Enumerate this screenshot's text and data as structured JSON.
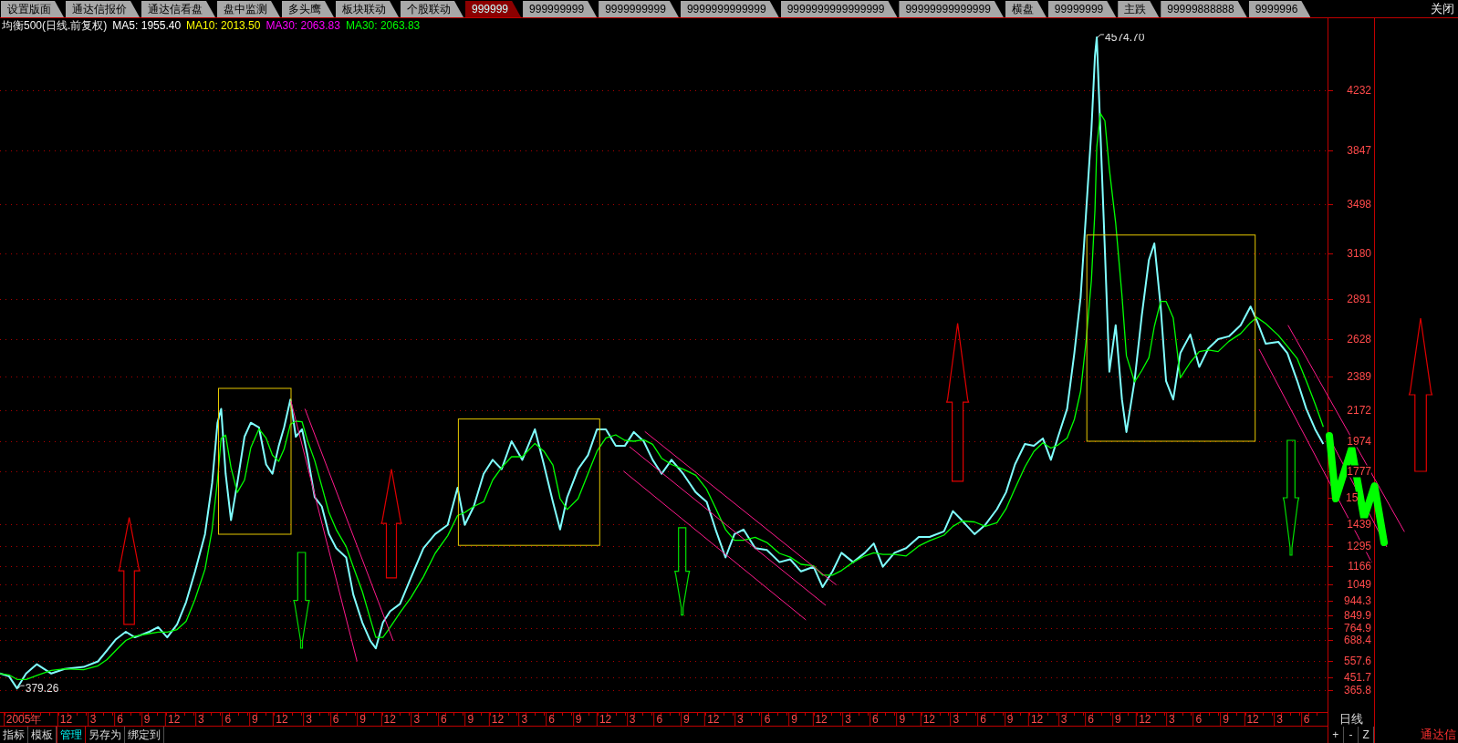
{
  "tabs": [
    {
      "label": "设置版面",
      "selected": false
    },
    {
      "label": "通达信报价",
      "selected": false
    },
    {
      "label": "通达信看盘",
      "selected": false
    },
    {
      "label": "盘中监测",
      "selected": false
    },
    {
      "label": "多头鹰",
      "selected": false
    },
    {
      "label": "板块联动",
      "selected": false
    },
    {
      "label": "个股联动",
      "selected": false
    },
    {
      "label": "999999",
      "selected": true
    },
    {
      "label": "999999999",
      "selected": false
    },
    {
      "label": "9999999999",
      "selected": false
    },
    {
      "label": "9999999999999",
      "selected": false
    },
    {
      "label": "9999999999999999",
      "selected": false
    },
    {
      "label": "99999999999999",
      "selected": false
    },
    {
      "label": "横盘",
      "selected": false
    },
    {
      "label": "99999999",
      "selected": false
    },
    {
      "label": "主跌",
      "selected": false
    },
    {
      "label": "99999888888",
      "selected": false
    },
    {
      "label": "9999996",
      "selected": false
    }
  ],
  "close_button": "关闭",
  "chart": {
    "title": "均衡500(日线.前复权)",
    "indicators": [
      {
        "label": "MA5: 1955.40",
        "color": "#ffffff"
      },
      {
        "label": "MA10: 2013.50",
        "color": "#ffff00"
      },
      {
        "label": "MA30: 2063.83",
        "color": "#ff00ff"
      },
      {
        "label": "MA30: 2063.83",
        "color": "#00ff00"
      }
    ],
    "chart_data": {
      "type": "line",
      "grid": true,
      "x": [
        "2005-04-25",
        "2005-05-25",
        "2005-06-22",
        "2005-07-22",
        "2005-08-28",
        "2005-10-16",
        "2005-12-01",
        "2006-02-04",
        "2006-03-22",
        "2006-04-22",
        "2006-05-22",
        "2006-06-25",
        "2006-07-25",
        "2006-09-13",
        "2006-10-13",
        "2006-11-13",
        "2006-12-16",
        "2007-01-16",
        "2007-02-16",
        "2007-03-19",
        "2007-04-13",
        "2007-05-01",
        "2007-05-13",
        "2007-05-28",
        "2007-06-16",
        "2007-07-07",
        "2007-08-01",
        "2007-08-22",
        "2007-09-19",
        "2007-10-13",
        "2007-11-04",
        "2007-11-25",
        "2007-12-13",
        "2008-01-04",
        "2008-01-22",
        "2008-02-13",
        "2008-03-01",
        "2008-03-25",
        "2008-04-19",
        "2008-05-13",
        "2008-06-07",
        "2008-07-10",
        "2008-08-04",
        "2008-09-04",
        "2008-10-01",
        "2008-10-19",
        "2008-11-13",
        "2008-12-07",
        "2009-01-10",
        "2009-02-16",
        "2009-03-28",
        "2009-05-07",
        "2009-06-19",
        "2009-07-22",
        "2009-08-16",
        "2009-09-16",
        "2009-10-19",
        "2009-11-19",
        "2009-12-19",
        "2010-01-22",
        "2010-02-28",
        "2010-04-10",
        "2010-05-10",
        "2010-06-10",
        "2010-07-04",
        "2010-07-28",
        "2010-09-04",
        "2010-10-07",
        "2010-11-07",
        "2010-12-07",
        "2011-01-10",
        "2011-02-10",
        "2011-03-10",
        "2011-04-13",
        "2011-05-13",
        "2011-06-13",
        "2011-07-16",
        "2011-08-25",
        "2011-10-07",
        "2011-11-13",
        "2011-12-13",
        "2012-01-16",
        "2012-02-16",
        "2012-03-16",
        "2012-04-25",
        "2012-06-04",
        "2012-07-16",
        "2012-08-22",
        "2012-09-28",
        "2012-11-10",
        "2012-12-10",
        "2013-01-13",
        "2013-02-13",
        "2013-03-22",
        "2013-05-01",
        "2013-06-01",
        "2013-07-01",
        "2013-08-10",
        "2013-09-19",
        "2013-11-01",
        "2013-12-07",
        "2014-01-25",
        "2014-02-25",
        "2014-03-25",
        "2014-05-07",
        "2014-06-13",
        "2014-07-22",
        "2014-08-22",
        "2014-09-22",
        "2014-10-25",
        "2014-11-25",
        "2014-12-25",
        "2015-01-22",
        "2015-02-16",
        "2015-03-16",
        "2015-04-10",
        "2015-05-01",
        "2015-05-19",
        "2015-06-07",
        "2015-06-19",
        "2015-06-25",
        "2015-07-07",
        "2015-07-22",
        "2015-08-07",
        "2015-08-28",
        "2015-09-19",
        "2015-10-04",
        "2015-11-01",
        "2015-11-25",
        "2015-12-19",
        "2016-01-07",
        "2016-01-28",
        "2016-02-16",
        "2016-03-10",
        "2016-04-04",
        "2016-05-07",
        "2016-06-07",
        "2016-07-07",
        "2016-08-10",
        "2016-09-16",
        "2016-10-25",
        "2016-11-28",
        "2016-12-19",
        "2017-01-19",
        "2017-03-01",
        "2017-04-01",
        "2017-05-04",
        "2017-06-04",
        "2017-07-04",
        "2017-08-01"
      ],
      "series": [
        {
          "color": "#80ffff",
          "values": [
            475,
            457,
            379,
            475,
            535,
            475,
            505,
            517,
            553,
            625,
            696,
            744,
            708,
            744,
            774,
            708,
            792,
            936,
            1133,
            1373,
            1702,
            2091,
            2181,
            1762,
            1463,
            1702,
            2001,
            2091,
            2061,
            1822,
            1762,
            1942,
            2061,
            2241,
            2001,
            2049,
            1882,
            1612,
            1552,
            1373,
            1283,
            1223,
            984,
            804,
            684,
            637,
            804,
            876,
            924,
            1091,
            1283,
            1373,
            1433,
            1672,
            1433,
            1552,
            1762,
            1852,
            1792,
            1972,
            1852,
            2049,
            1822,
            1582,
            1403,
            1612,
            1792,
            1882,
            2049,
            2049,
            1942,
            1942,
            2031,
            1972,
            1852,
            1762,
            1852,
            1762,
            1642,
            1582,
            1403,
            1223,
            1373,
            1403,
            1283,
            1271,
            1193,
            1211,
            1133,
            1163,
            1032,
            1133,
            1253,
            1193,
            1253,
            1313,
            1163,
            1253,
            1283,
            1355,
            1355,
            1391,
            1522,
            1462,
            1373,
            1433,
            1534,
            1642,
            1822,
            1954,
            1942,
            1990,
            1852,
            2001,
            2181,
            2540,
            2900,
            3438,
            3977,
            4456,
            4575,
            3977,
            3199,
            2420,
            2720,
            2241,
            2031,
            2361,
            2780,
            3139,
            3247,
            2840,
            2361,
            2241,
            2540,
            2660,
            2450,
            2570,
            2630,
            2648,
            2720,
            2840,
            2750,
            2600,
            2612,
            2540,
            2361,
            2181,
            2049,
            1955
          ]
        },
        {
          "color": "#00ff00",
          "values": [
            475,
            466,
            437,
            437,
            463,
            495,
            505,
            499,
            525,
            565,
            625,
            688,
            716,
            732,
            742,
            742,
            758,
            812,
            954,
            1147,
            1403,
            1722,
            1991,
            2011,
            1802,
            1642,
            1722,
            1931,
            2051,
            1991,
            1882,
            1842,
            1922,
            2081,
            2101,
            2097,
            1977,
            1848,
            1682,
            1512,
            1403,
            1293,
            1163,
            1004,
            824,
            708,
            708,
            772,
            868,
            964,
            1099,
            1249,
            1363,
            1493,
            1513,
            1552,
            1582,
            1722,
            1802,
            1872,
            1872,
            1958,
            1908,
            1818,
            1602,
            1532,
            1602,
            1762,
            1908,
            1993,
            2013,
            1978,
            1972,
            1982,
            1952,
            1862,
            1822,
            1792,
            1752,
            1662,
            1542,
            1403,
            1333,
            1333,
            1353,
            1319,
            1249,
            1225,
            1179,
            1169,
            1109,
            1109,
            1139,
            1193,
            1233,
            1253,
            1243,
            1243,
            1233,
            1297,
            1331,
            1367,
            1423,
            1458,
            1452,
            1423,
            1447,
            1536,
            1666,
            1806,
            1906,
            1962,
            1928,
            1948,
            1993,
            2113,
            2295,
            2612,
            3007,
            3462,
            3869,
            4085,
            4037,
            3725,
            3378,
            2911,
            2522,
            2355,
            2427,
            2510,
            2712,
            2873,
            2873,
            2766,
            2381,
            2480,
            2550,
            2560,
            2550,
            2616,
            2666,
            2736,
            2770,
            2730,
            2654,
            2584,
            2504,
            2361,
            2211,
            2064
          ]
        }
      ],
      "xlim": [
        "2005-04-25",
        "2017-08-15"
      ],
      "ylim": [
        227,
        4598
      ],
      "xticks": [
        {
          "value": "2005-07-10",
          "label": "2005年"
        },
        {
          "value": "2005-12-01",
          "label": "12"
        },
        {
          "value": "2006-03-01",
          "label": "3"
        },
        {
          "value": "2006-06-01",
          "label": "6"
        },
        {
          "value": "2006-09-01",
          "label": "9"
        },
        {
          "value": "2006-12-01",
          "label": "12"
        },
        {
          "value": "2007-03-01",
          "label": "3"
        },
        {
          "value": "2007-06-01",
          "label": "6"
        },
        {
          "value": "2007-09-01",
          "label": "9"
        },
        {
          "value": "2007-12-01",
          "label": "12"
        },
        {
          "value": "2008-03-01",
          "label": "3"
        },
        {
          "value": "2008-06-01",
          "label": "6"
        },
        {
          "value": "2008-09-01",
          "label": "9"
        },
        {
          "value": "2008-12-01",
          "label": "12"
        },
        {
          "value": "2009-03-01",
          "label": "3"
        },
        {
          "value": "2009-06-01",
          "label": "6"
        },
        {
          "value": "2009-09-01",
          "label": "9"
        },
        {
          "value": "2009-12-01",
          "label": "12"
        },
        {
          "value": "2010-03-01",
          "label": "3"
        },
        {
          "value": "2010-06-01",
          "label": "6"
        },
        {
          "value": "2010-09-01",
          "label": "9"
        },
        {
          "value": "2010-12-01",
          "label": "12"
        },
        {
          "value": "2011-03-01",
          "label": "3"
        },
        {
          "value": "2011-06-01",
          "label": "6"
        },
        {
          "value": "2011-09-01",
          "label": "9"
        },
        {
          "value": "2011-12-01",
          "label": "12"
        },
        {
          "value": "2012-03-01",
          "label": "3"
        },
        {
          "value": "2012-06-01",
          "label": "6"
        },
        {
          "value": "2012-09-01",
          "label": "9"
        },
        {
          "value": "2012-12-01",
          "label": "12"
        },
        {
          "value": "2013-03-01",
          "label": "3"
        },
        {
          "value": "2013-06-01",
          "label": "6"
        },
        {
          "value": "2013-09-01",
          "label": "9"
        },
        {
          "value": "2013-12-01",
          "label": "12"
        },
        {
          "value": "2014-03-01",
          "label": "3"
        },
        {
          "value": "2014-06-01",
          "label": "6"
        },
        {
          "value": "2014-09-01",
          "label": "9"
        },
        {
          "value": "2014-12-01",
          "label": "12"
        },
        {
          "value": "2015-03-01",
          "label": "3"
        },
        {
          "value": "2015-06-01",
          "label": "6"
        },
        {
          "value": "2015-09-01",
          "label": "9"
        },
        {
          "value": "2015-12-01",
          "label": "12"
        },
        {
          "value": "2016-03-01",
          "label": "3"
        },
        {
          "value": "2016-06-01",
          "label": "6"
        },
        {
          "value": "2016-09-01",
          "label": "9"
        },
        {
          "value": "2016-12-01",
          "label": "12"
        },
        {
          "value": "2017-03-01",
          "label": "3"
        },
        {
          "value": "2017-06-01",
          "label": "6"
        }
      ],
      "yticks": [
        4232,
        3847,
        3498,
        3180,
        2891,
        2628,
        2389,
        2172,
        1974,
        1777,
        1439,
        1295,
        1166,
        1049,
        944.3,
        849.9,
        764.9,
        688.4,
        557.6,
        451.7,
        365.8
      ],
      "annotations": [
        {
          "text": "4574.70",
          "x": "2015-06-25",
          "y": 4575
        },
        {
          "text": "379.26",
          "x": "2005-06-22",
          "y": 379
        }
      ]
    },
    "covered_axis_label": "15",
    "period_label": "日线",
    "zoom_buttons": [
      "+",
      "-",
      "Z"
    ]
  },
  "bottom_toolbar": [
    {
      "label": "指标",
      "selected": false
    },
    {
      "label": "模板",
      "selected": false
    },
    {
      "label": "管理",
      "selected": true
    },
    {
      "label": "另存为",
      "selected": false
    },
    {
      "label": "绑定到",
      "selected": false
    }
  ],
  "brand": "通达信"
}
